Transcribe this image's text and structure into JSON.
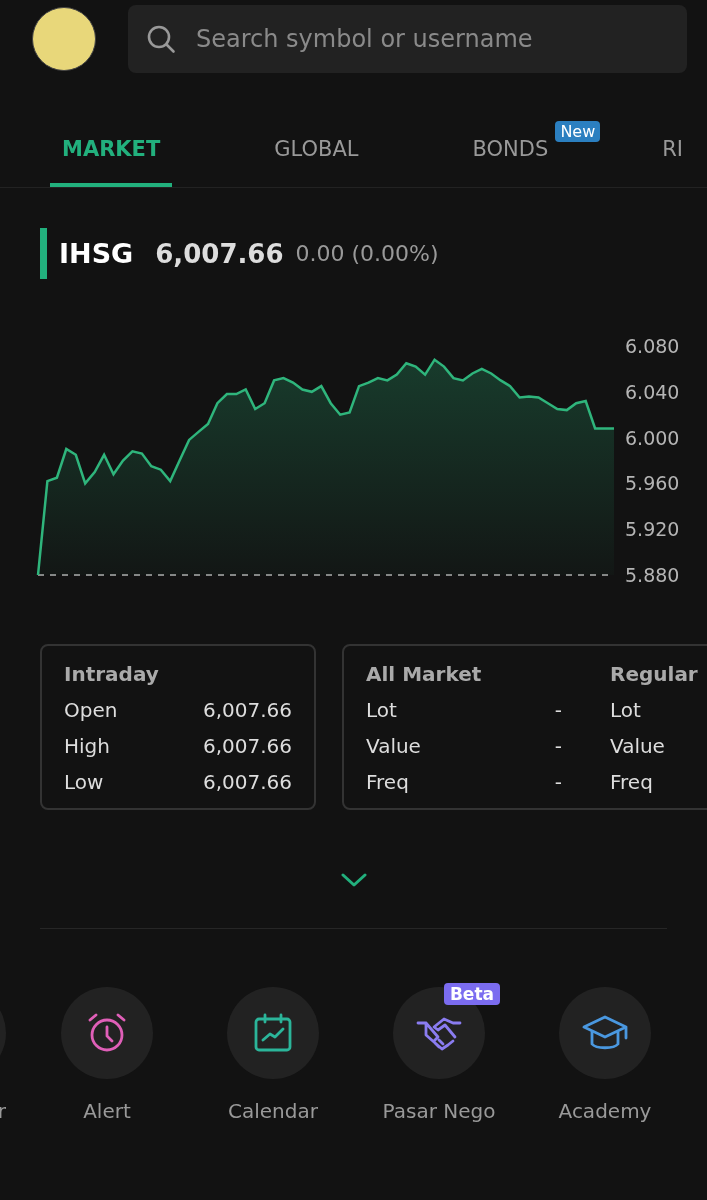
{
  "search": {
    "placeholder": "Search symbol or username"
  },
  "tabs": [
    {
      "label": "MARKET",
      "selected": true
    },
    {
      "label": "GLOBAL",
      "selected": false
    },
    {
      "label": "BONDS",
      "selected": false,
      "badge": "New"
    },
    {
      "label": "RI",
      "selected": false
    }
  ],
  "index": {
    "symbol": "IHSG",
    "price": "6,007.66",
    "change": "0.00 (0.00%)"
  },
  "chart_data": {
    "type": "line",
    "ylim": [
      5.88,
      6.08
    ],
    "yticks": [
      {
        "value": 6.08,
        "label": "6.080"
      },
      {
        "value": 6.04,
        "label": "6.040"
      },
      {
        "value": 6.0,
        "label": "6.000"
      },
      {
        "value": 5.96,
        "label": "5.960"
      },
      {
        "value": 5.92,
        "label": "5.920"
      },
      {
        "value": 5.88,
        "label": "5.880"
      }
    ],
    "series": [
      {
        "color": "#2fb57c",
        "values": [
          5.88,
          5.962,
          5.965,
          5.99,
          5.985,
          5.96,
          5.97,
          5.985,
          5.968,
          5.98,
          5.988,
          5.986,
          5.975,
          5.972,
          5.962,
          5.98,
          5.998,
          6.005,
          6.012,
          6.03,
          6.038,
          6.038,
          6.042,
          6.025,
          6.03,
          6.05,
          6.052,
          6.048,
          6.042,
          6.04,
          6.045,
          6.03,
          6.02,
          6.022,
          6.045,
          6.048,
          6.052,
          6.05,
          6.055,
          6.065,
          6.062,
          6.055,
          6.068,
          6.062,
          6.052,
          6.05,
          6.056,
          6.06,
          6.056,
          6.05,
          6.045,
          6.035,
          6.036,
          6.035,
          6.03,
          6.025,
          6.024,
          6.03,
          6.032,
          6.008,
          6.008,
          6.008
        ]
      }
    ]
  },
  "cards": [
    {
      "sections": [
        {
          "title": "Intraday",
          "rows": [
            {
              "label": "Open",
              "value": "6,007.66"
            },
            {
              "label": "High",
              "value": "6,007.66"
            },
            {
              "label": "Low",
              "value": "6,007.66"
            }
          ]
        }
      ]
    },
    {
      "sections": [
        {
          "title": "All Market",
          "rows": [
            {
              "label": "Lot",
              "value": "-"
            },
            {
              "label": "Value",
              "value": "-"
            },
            {
              "label": "Freq",
              "value": "-"
            }
          ]
        },
        {
          "title": "Regular",
          "rows": [
            {
              "label": "Lot"
            },
            {
              "label": "Value"
            },
            {
              "label": "Freq"
            }
          ]
        }
      ]
    }
  ],
  "shortcuts": [
    {
      "kind": "partial",
      "label": "r"
    },
    {
      "kind": "alarm",
      "label": "Alert"
    },
    {
      "kind": "calendar",
      "label": "Calendar"
    },
    {
      "kind": "handshake",
      "label": "Pasar Nego",
      "badge": "Beta"
    },
    {
      "kind": "cap",
      "label": "Academy"
    }
  ]
}
